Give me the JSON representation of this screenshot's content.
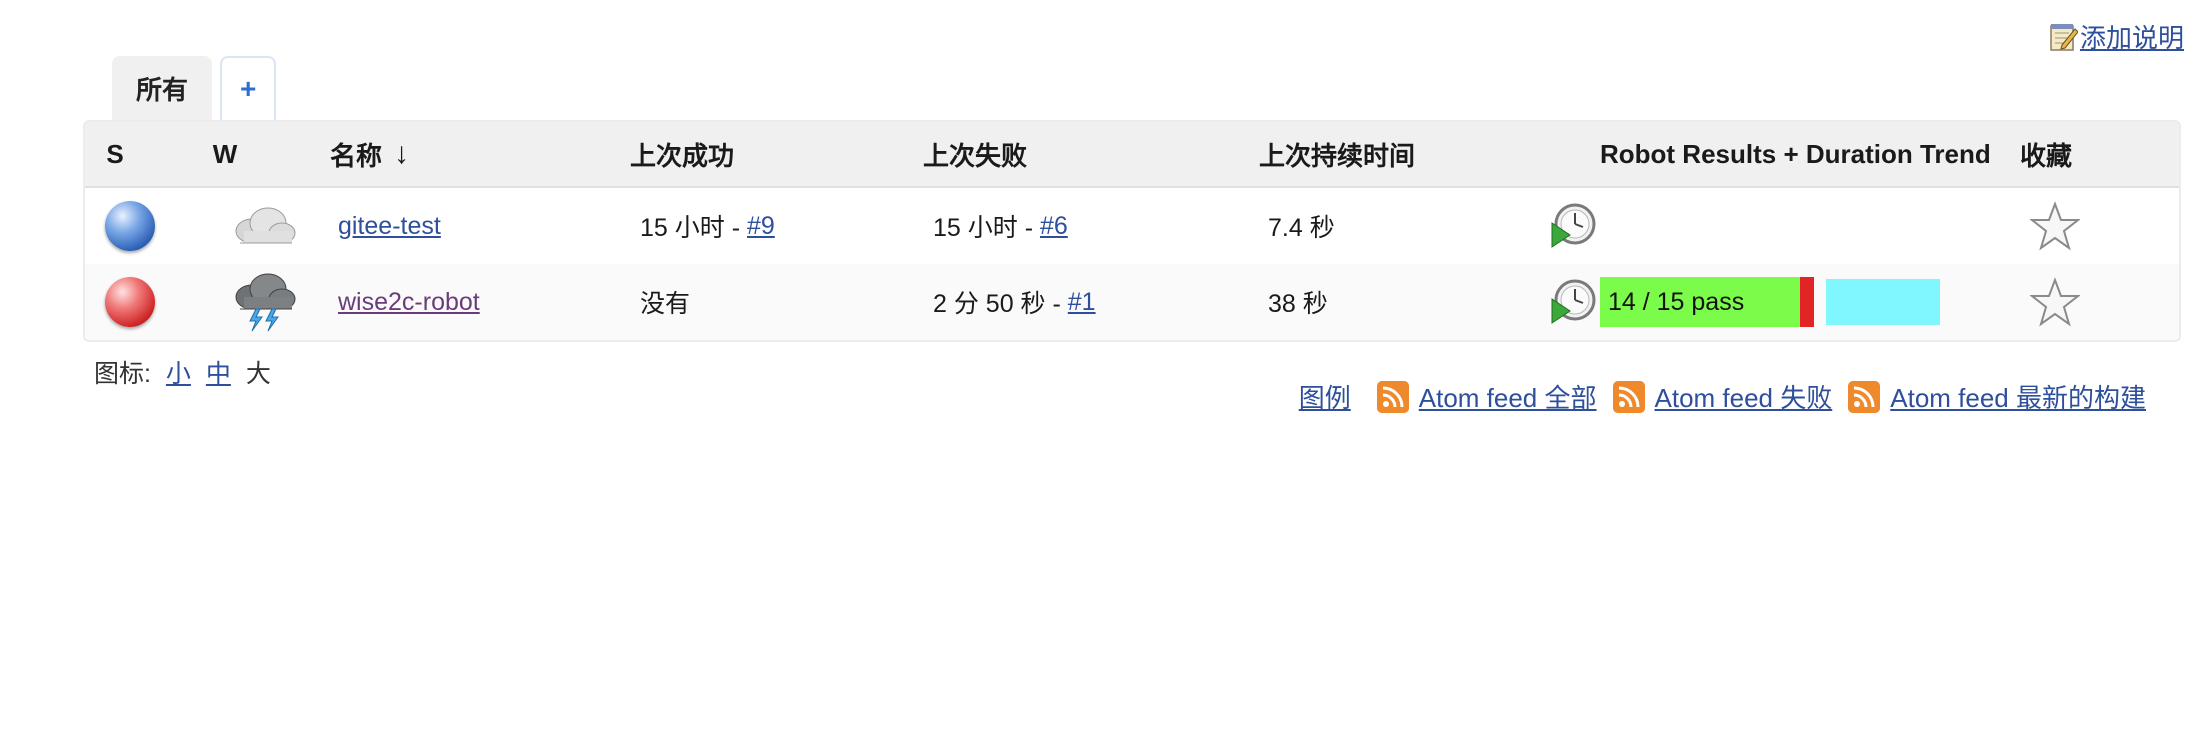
{
  "header": {
    "add_description": "添加说明"
  },
  "tabs": [
    {
      "label": "所有"
    },
    {
      "label": "+"
    }
  ],
  "table": {
    "headers": {
      "s": "S",
      "w": "W",
      "name": "名称",
      "sort_arrow": "↓",
      "last_success": "上次成功",
      "last_failure": "上次失败",
      "last_duration": "上次持续时间",
      "robot": "Robot Results + Duration Trend",
      "favorite": "收藏"
    },
    "rows": [
      {
        "status": "blue",
        "weather": "cloudy",
        "name": "gitee-test",
        "last_success_text": "15 小时 - ",
        "last_success_build": "#9",
        "last_failure_text": "15 小时 - ",
        "last_failure_build": "#6",
        "last_duration": "7.4 秒"
      },
      {
        "status": "red",
        "weather": "thunderstorm",
        "name": "wise2c-robot",
        "last_success_text": "没有",
        "last_failure_text": "2 分 50 秒 - ",
        "last_failure_build": "#1",
        "last_duration": "38 秒",
        "robot": {
          "label": "14 / 15 pass",
          "passed": 14,
          "total": 15
        }
      }
    ]
  },
  "icon_size": {
    "label": "图标:",
    "small": "小",
    "medium": "中",
    "large": "大"
  },
  "footer": {
    "legend": "图例",
    "feed_all": "Atom feed 全部",
    "feed_failures": "Atom feed 失败",
    "feed_latest": "Atom feed 最新的构建"
  },
  "colors": {
    "link": "#2e4f9c",
    "pass": "#7cfc4a",
    "fail": "#e22424",
    "duration": "#80f7ff"
  }
}
